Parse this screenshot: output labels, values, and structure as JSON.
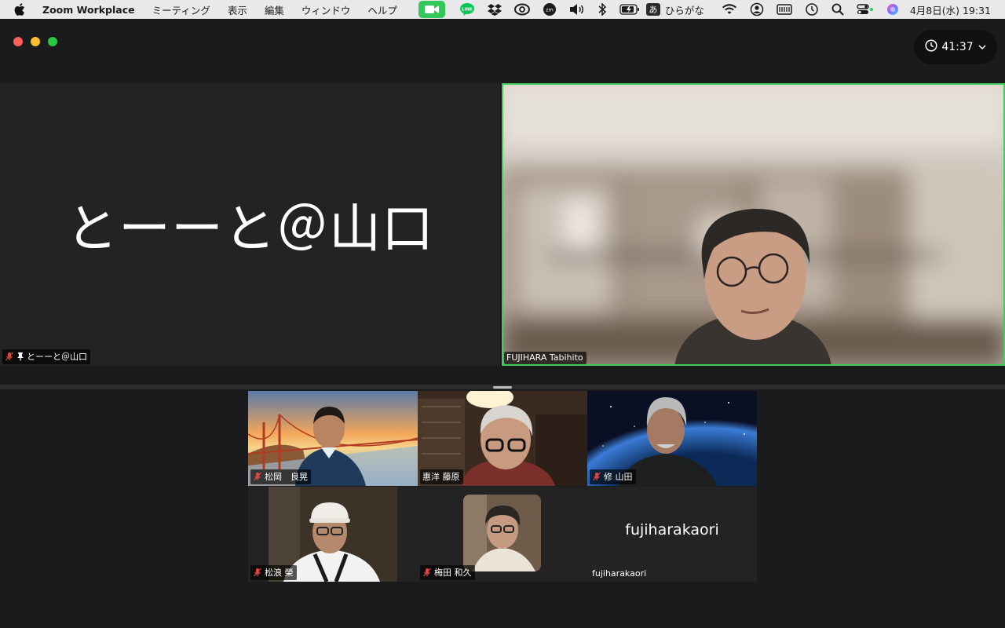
{
  "menubar": {
    "app_name": "Zoom Workplace",
    "items": [
      "ミーティング",
      "表示",
      "編集",
      "ウィンドウ",
      "ヘルプ"
    ],
    "ime_badge": "あ",
    "ime_label": "ひらがな",
    "clock": "4月8日(水)  19:31"
  },
  "meeting": {
    "elapsed_time": "41:37"
  },
  "tiles": {
    "main_left": {
      "display_name": "とーーと＠山口",
      "label": "とーーと＠山口"
    },
    "main_right": {
      "label": "FUJIHARA Tabihito",
      "active_speaker_color": "#3ecf5a"
    },
    "gallery": [
      {
        "label": "松岡　良晃"
      },
      {
        "label": "惠洋 藤原"
      },
      {
        "label": "修 山田"
      },
      {
        "label": "松浪 榮"
      },
      {
        "label": "梅田 和久"
      },
      {
        "display_name": "fujiharakaori",
        "label": "fujiharakaori"
      }
    ]
  },
  "colors": {
    "window_bg": "#1a1b1d",
    "tile_bg": "#232323",
    "muted_icon": "#e0443e",
    "zoom_indicator": "#34c759"
  }
}
